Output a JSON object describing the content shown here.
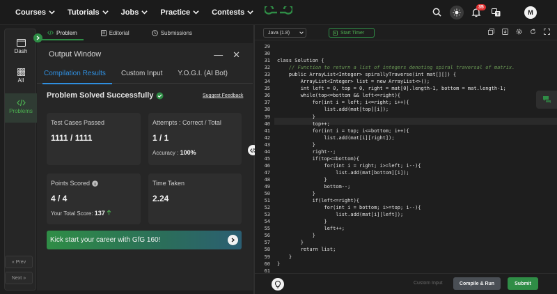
{
  "nav": {
    "items": [
      "Courses",
      "Tutorials",
      "Jobs",
      "Practice",
      "Contests"
    ],
    "notification_count": "35",
    "avatar_initial": "M"
  },
  "rail": {
    "items": [
      {
        "label": "Dash",
        "icon": "dashboard-icon"
      },
      {
        "label": "All",
        "icon": "grid-icon"
      },
      {
        "label": "Problems",
        "icon": "code-icon"
      }
    ],
    "prev_label": "Prev",
    "next_label": "Next"
  },
  "tabs": [
    {
      "label": "Problem",
      "icon": "code-icon"
    },
    {
      "label": "Editorial",
      "icon": "document-icon"
    },
    {
      "label": "Submissions",
      "icon": "clock-icon"
    }
  ],
  "output": {
    "title": "Output Window",
    "tabs": [
      "Compilation Results",
      "Custom Input",
      "Y.O.G.I. (AI Bot)"
    ],
    "status": "Problem Solved Successfully",
    "suggest_feedback": "Suggest Feedback",
    "cards": {
      "tests_label": "Test Cases Passed",
      "tests_value": "1111 / 1111",
      "attempts_label": "Attempts : Correct / Total",
      "attempts_value": "1 / 1",
      "accuracy_label": "Accuracy :",
      "accuracy_value": "100%",
      "points_label": "Points Scored",
      "points_value": "4 / 4",
      "total_label": "Your Total Score:",
      "total_value": "137",
      "time_label": "Time Taken",
      "time_value": "2.24"
    },
    "banner": "Kick start your career with GfG 160!"
  },
  "editor": {
    "language": "Java (1.8)",
    "timer": "Start Timer",
    "lines": [
      {
        "n": "29",
        "code": ""
      },
      {
        "n": "30",
        "code": ""
      },
      {
        "n": "31",
        "code": "class Solution {"
      },
      {
        "n": "32",
        "code": "    // Function to return a list of integers denoting spiral traversal of matrix.",
        "comment": true
      },
      {
        "n": "33",
        "code": "    public ArrayList<Integer> spirallyTraverse(int mat[][]) {"
      },
      {
        "n": "34",
        "code": "        ArrayList<Integer> list = new ArrayList<>();"
      },
      {
        "n": "35",
        "code": "        int left = 0, top = 0, right = mat[0].length-1, bottom = mat.length-1;"
      },
      {
        "n": "36",
        "code": "        while(top<=bottom && left<=right){"
      },
      {
        "n": "37",
        "code": "            for(int i = left; i<=right; i++){"
      },
      {
        "n": "38",
        "code": "                list.add(mat[top][i]);"
      },
      {
        "n": "39",
        "code": "            }"
      },
      {
        "n": "40",
        "code": "            top++;"
      },
      {
        "n": "41",
        "code": "            for(int i = top; i<=bottom; i++){"
      },
      {
        "n": "42",
        "code": "                list.add(mat[i][right]);"
      },
      {
        "n": "43",
        "code": "            }"
      },
      {
        "n": "44",
        "code": "            right--;"
      },
      {
        "n": "45",
        "code": "            if(top<=bottom){"
      },
      {
        "n": "46",
        "code": "                for(int i = right; i>=left; i--){"
      },
      {
        "n": "47",
        "code": "                    list.add(mat[bottom][i]);"
      },
      {
        "n": "48",
        "code": "                }"
      },
      {
        "n": "49",
        "code": "                bottom--;"
      },
      {
        "n": "50",
        "code": "            }"
      },
      {
        "n": "51",
        "code": "            if(left<=right){"
      },
      {
        "n": "52",
        "code": "                for(int i = bottom; i>=top; i--){"
      },
      {
        "n": "53",
        "code": "                    list.add(mat[i][left]);"
      },
      {
        "n": "54",
        "code": "                }"
      },
      {
        "n": "55",
        "code": "                left++;"
      },
      {
        "n": "56",
        "code": "            }"
      },
      {
        "n": "57",
        "code": "        }"
      },
      {
        "n": "58",
        "code": "        return list;"
      },
      {
        "n": "59",
        "code": "    }"
      },
      {
        "n": "60",
        "code": "}"
      },
      {
        "n": "61",
        "code": ""
      }
    ],
    "custom_input": "Custom Input",
    "compile_run": "Compile & Run",
    "submit": "Submit"
  },
  "colors": {
    "accent": "#2f8d46",
    "link": "#2f8fe0",
    "badge": "#e03131"
  }
}
